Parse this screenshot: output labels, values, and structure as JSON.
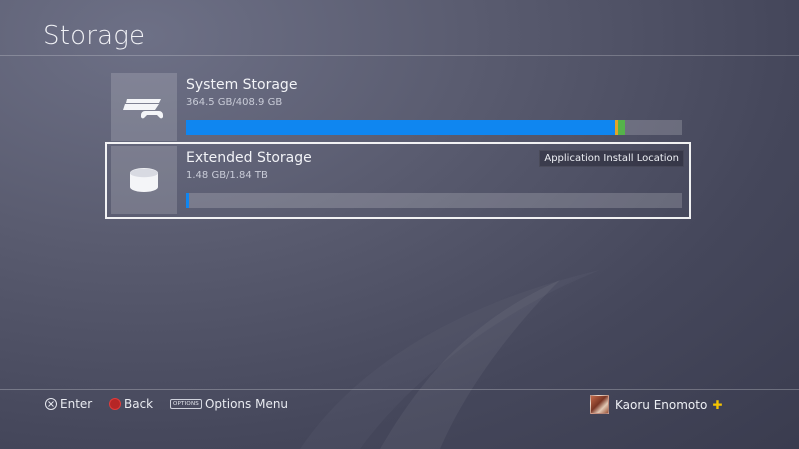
{
  "header": {
    "title": "Storage"
  },
  "storages": [
    {
      "name": "System Storage",
      "usage": "364.5 GB/408.9 GB",
      "icon": "ps4-console-icon",
      "fill_fraction": 0.865,
      "segments": [
        {
          "color": "#e0a52a",
          "fraction": 0.006
        },
        {
          "color": "#55b34a",
          "fraction": 0.014
        }
      ]
    },
    {
      "name": "Extended Storage",
      "usage": "1.48 GB/1.84 TB",
      "icon": "external-drive-icon",
      "fill_fraction": 0.006,
      "badge": "Application Install Location"
    }
  ],
  "footer": {
    "enter_label": "Enter",
    "back_label": "Back",
    "options_glyph": "OPTIONS",
    "options_label": "Options Menu",
    "username": "Kaoru Enomoto"
  },
  "colors": {
    "accent": "#0f86f0",
    "plus": "#f5c400"
  }
}
